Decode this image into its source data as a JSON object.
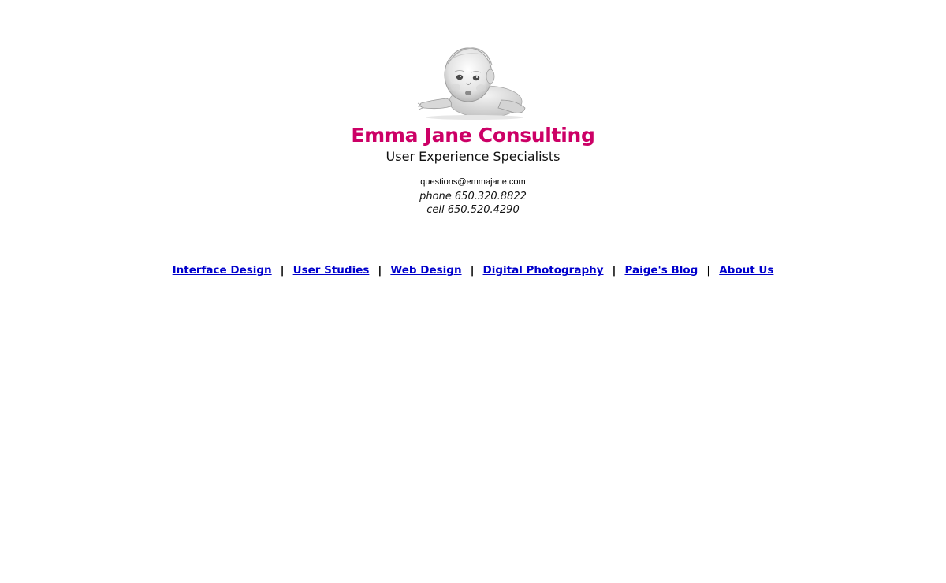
{
  "header": {
    "logo_icon": "baby-photo-sketch",
    "company_name": "Emma Jane Consulting",
    "tagline": "User Experience Specialists",
    "company_color": "#cc0066"
  },
  "contact": {
    "email": "questions@emmajane.com",
    "phone": "phone 650.320.8822",
    "cell": "cell 650.520.4290"
  },
  "nav": {
    "separator": "|",
    "link_color": "#0000cc",
    "items": [
      {
        "label": "Interface Design"
      },
      {
        "label": "User Studies"
      },
      {
        "label": "Web Design"
      },
      {
        "label": "Digital Photography"
      },
      {
        "label": "Paige's Blog"
      },
      {
        "label": "About Us"
      }
    ]
  }
}
